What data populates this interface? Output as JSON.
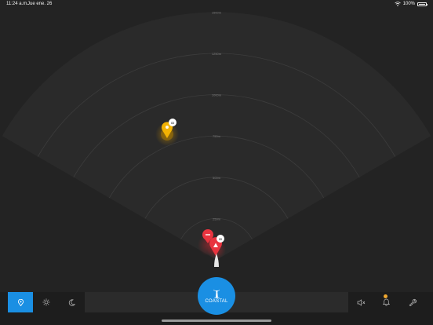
{
  "status_bar": {
    "time": "11:24 a.m.",
    "date": "Jue ene. 26",
    "battery": "100%"
  },
  "radar": {
    "range_labels": [
      "250m",
      "500m",
      "750m",
      "1000m",
      "1250m",
      "1500m"
    ],
    "sector_angle_deg": 120,
    "colors": {
      "background": "#232323",
      "sector_fill": "#2a2a2a",
      "ring": "#3c3c3c",
      "label": "#7d7d7d",
      "danger": "#e8343f",
      "warning": "#f2b203"
    },
    "targets": [
      {
        "id": "target-warning",
        "status": "warning",
        "icon": "diver-icon",
        "range_m": 820,
        "bearing_deg": -35
      },
      {
        "id": "target-danger-a",
        "status": "danger",
        "icon": "minus-icon",
        "range_m": 100,
        "bearing_deg": -20
      },
      {
        "id": "target-danger-b",
        "status": "danger",
        "icon": "warning-icon",
        "range_m": 70,
        "bearing_deg": -5
      }
    ]
  },
  "bottom_bar": {
    "mode_label": "COASTAL",
    "location_icon": "location-pin-icon",
    "brightness_icon": "sun-icon",
    "night_icon": "moon-icon",
    "mute_icon": "speaker-muted-icon",
    "alarm_icon": "bell-icon",
    "tools_icon": "wrench-icon",
    "alarm_badge_color": "#f0a830"
  }
}
